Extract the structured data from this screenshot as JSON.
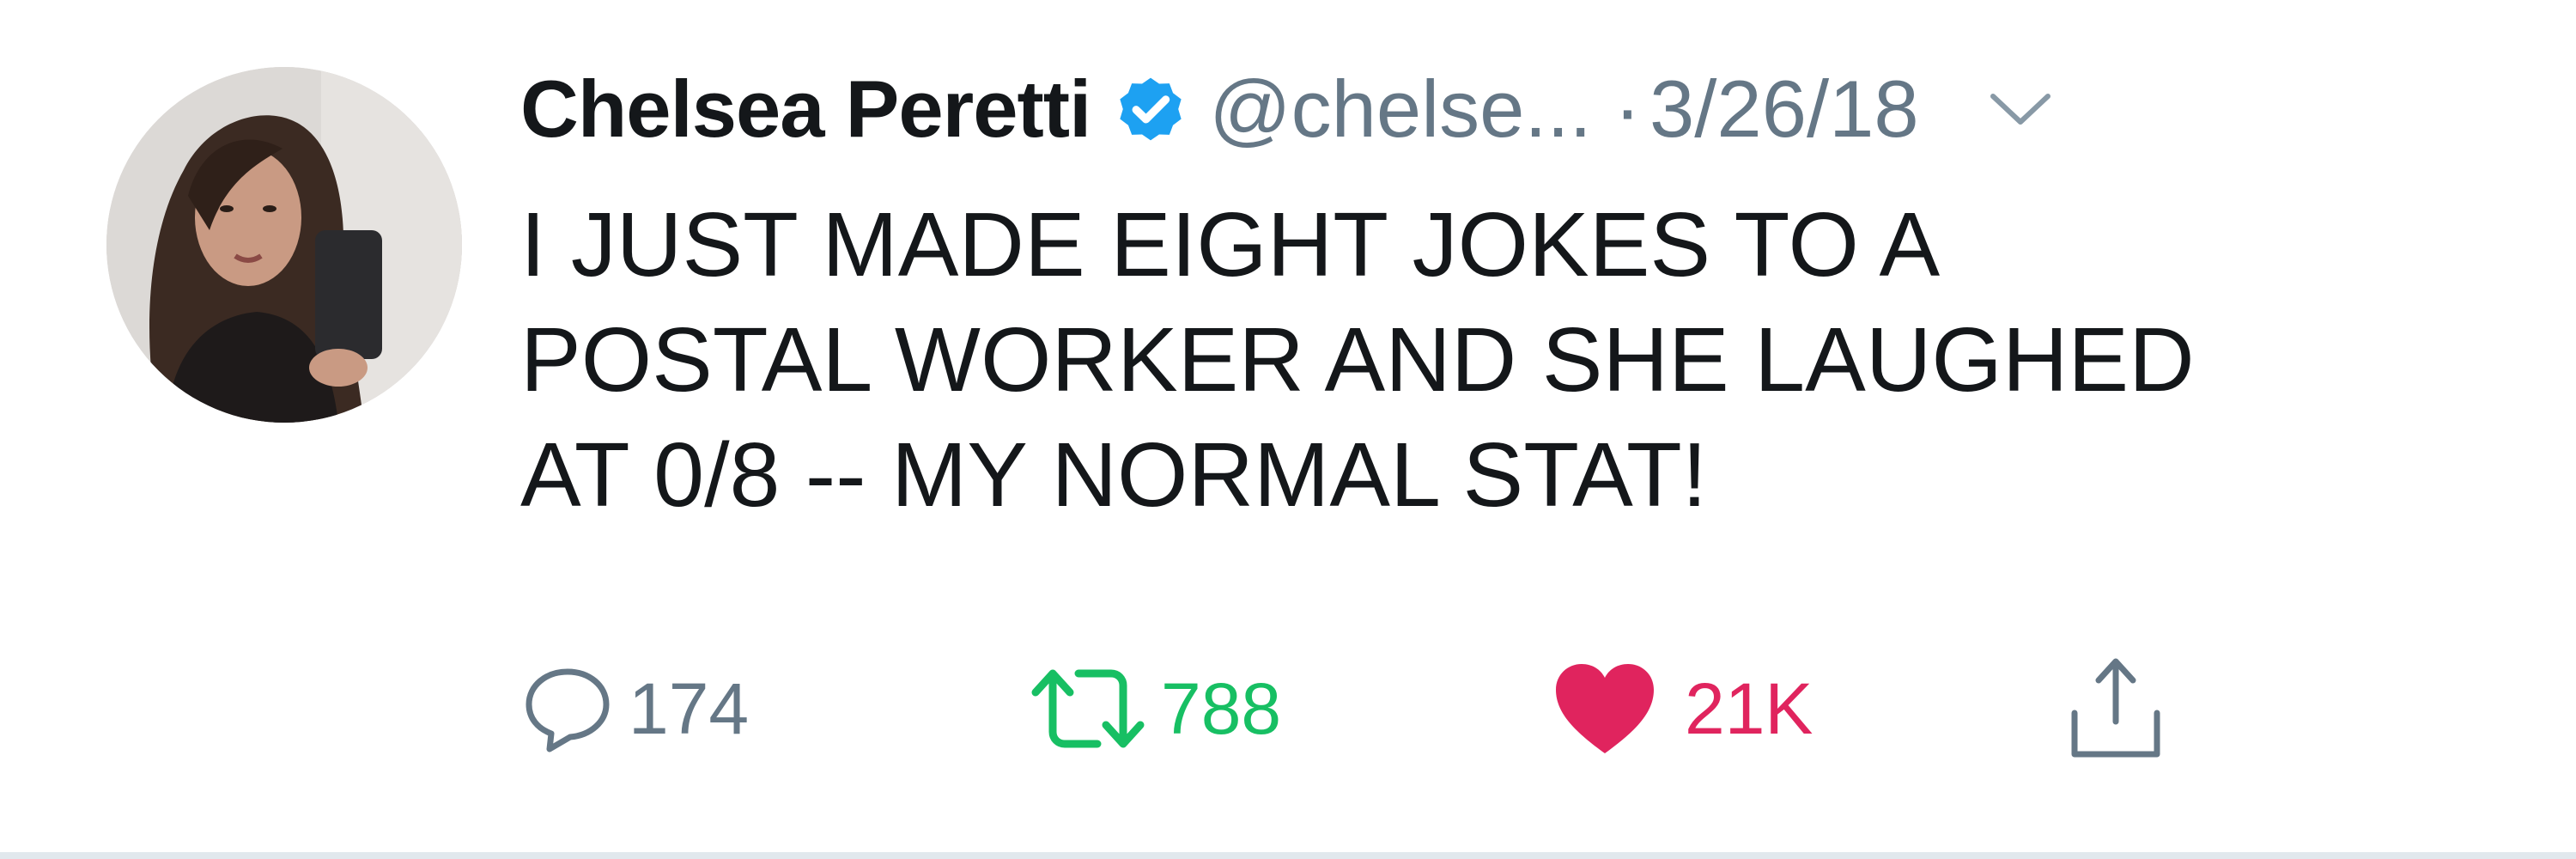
{
  "tweet": {
    "author": {
      "display_name": "Chelsea Peretti",
      "handle": "@chelse...",
      "verified": true
    },
    "separator": "·",
    "date": "3/26/18",
    "text_lines": [
      "I JUST MADE EIGHT JOKES TO A",
      "POSTAL WORKER AND SHE LAUGHED",
      "AT 0/8 -- MY NORMAL STAT!"
    ],
    "actions": {
      "reply": {
        "icon": "reply-icon",
        "count": "174"
      },
      "retweet": {
        "icon": "retweet-icon",
        "count": "788"
      },
      "like": {
        "icon": "heart-icon",
        "count": "21K"
      },
      "share": {
        "icon": "share-icon"
      }
    }
  },
  "colors": {
    "text_primary": "#14171a",
    "text_secondary": "#657786",
    "verified_blue": "#1da1f2",
    "retweet_green": "#17bf63",
    "like_red": "#e0245e",
    "divider": "#e1e8ed"
  }
}
